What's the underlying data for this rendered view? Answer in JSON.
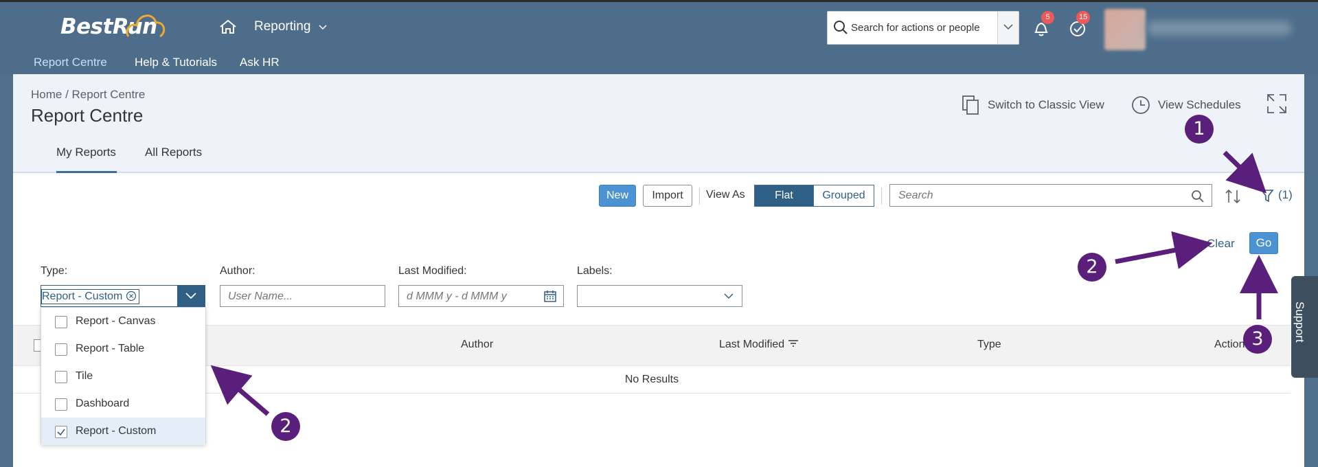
{
  "shell": {
    "logo": "BestRun",
    "reporting_menu": "Reporting",
    "search_placeholder": "Search for actions or people",
    "notifications_count": "5",
    "tasks_count": "15"
  },
  "nav": {
    "report_centre": "Report Centre",
    "help": "Help & Tutorials",
    "ask_hr": "Ask HR"
  },
  "header": {
    "breadcrumb": "Home / Report Centre",
    "title": "Report Centre",
    "classic_view": "Switch to Classic View",
    "view_schedules": "View Schedules"
  },
  "tabs": {
    "my_reports": "My Reports",
    "all_reports": "All Reports"
  },
  "toolbar": {
    "new": "New",
    "import": "Import",
    "view_as": "View As",
    "flat": "Flat",
    "grouped": "Grouped",
    "search_placeholder": "Search",
    "filter_count": "(1)"
  },
  "filters": {
    "clear": "Clear",
    "go": "Go",
    "type_label": "Type:",
    "type_token": "Report - Custom",
    "author_label": "Author:",
    "author_placeholder": "User Name...",
    "modified_label": "Last Modified:",
    "modified_placeholder": "d MMM y - d MMM y",
    "labels_label": "Labels:"
  },
  "type_options": [
    {
      "label": "Report - Canvas",
      "checked": false
    },
    {
      "label": "Report - Table",
      "checked": false
    },
    {
      "label": "Tile",
      "checked": false
    },
    {
      "label": "Dashboard",
      "checked": false
    },
    {
      "label": "Report - Custom",
      "checked": true
    }
  ],
  "table": {
    "col_author": "Author",
    "col_modified": "Last Modified",
    "col_type": "Type",
    "col_actions": "Action",
    "empty": "No Results"
  },
  "support": "Support",
  "annotations": {
    "one": "1",
    "two_a": "2",
    "two_b": "2",
    "three": "3",
    "color": "#5a1f7a"
  }
}
